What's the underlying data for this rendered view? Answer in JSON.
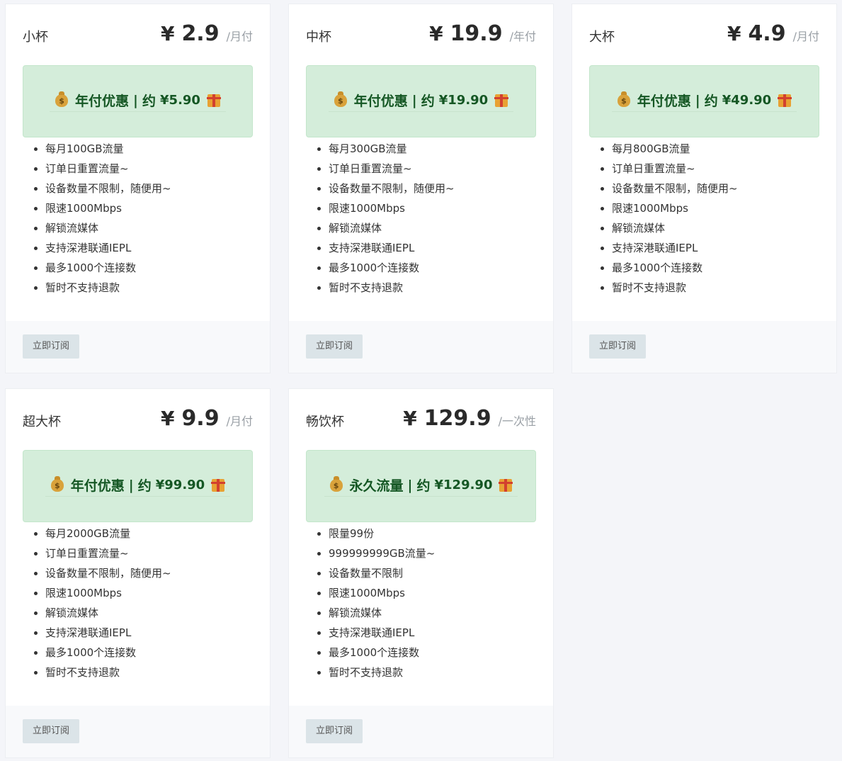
{
  "plans": [
    {
      "name": "小杯",
      "currency": "¥",
      "price": "2.9",
      "period": "/月付",
      "promo_title": "年付优惠",
      "promo_sep": "|",
      "promo_about": "约",
      "promo_price": "¥5.90",
      "features": [
        "每月100GB流量",
        "订单日重置流量~",
        "设备数量不限制，随便用~",
        "限速1000Mbps",
        "解锁流媒体",
        "支持深港联通IEPL",
        "最多1000个连接数",
        "暂时不支持退款"
      ],
      "button": "立即订阅"
    },
    {
      "name": "中杯",
      "currency": "¥",
      "price": "19.9",
      "period": "/年付",
      "promo_title": "年付优惠",
      "promo_sep": "|",
      "promo_about": "约",
      "promo_price": "¥19.90",
      "features": [
        "每月300GB流量",
        "订单日重置流量~",
        "设备数量不限制，随便用~",
        "限速1000Mbps",
        "解锁流媒体",
        "支持深港联通IEPL",
        "最多1000个连接数",
        "暂时不支持退款"
      ],
      "button": "立即订阅"
    },
    {
      "name": "大杯",
      "currency": "¥",
      "price": "4.9",
      "period": "/月付",
      "promo_title": "年付优惠",
      "promo_sep": "|",
      "promo_about": "约",
      "promo_price": "¥49.90",
      "features": [
        "每月800GB流量",
        "订单日重置流量~",
        "设备数量不限制，随便用~",
        "限速1000Mbps",
        "解锁流媒体",
        "支持深港联通IEPL",
        "最多1000个连接数",
        "暂时不支持退款"
      ],
      "button": "立即订阅"
    },
    {
      "name": "超大杯",
      "currency": "¥",
      "price": "9.9",
      "period": "/月付",
      "promo_title": "年付优惠",
      "promo_sep": "|",
      "promo_about": "约",
      "promo_price": "¥99.90",
      "features": [
        "每月2000GB流量",
        "订单日重置流量~",
        "设备数量不限制，随便用~",
        "限速1000Mbps",
        "解锁流媒体",
        "支持深港联通IEPL",
        "最多1000个连接数",
        "暂时不支持退款"
      ],
      "button": "立即订阅"
    },
    {
      "name": "畅饮杯",
      "currency": "¥",
      "price": "129.9",
      "period": "/一次性",
      "promo_title": "永久流量",
      "promo_sep": "|",
      "promo_about": "约",
      "promo_price": "¥129.90",
      "features": [
        "限量99份",
        "999999999GB流量~",
        "设备数量不限制",
        "限速1000Mbps",
        "解锁流媒体",
        "支持深港联通IEPL",
        "最多1000个连接数",
        "暂时不支持退款"
      ],
      "button": "立即订阅"
    }
  ],
  "icons": {
    "promo_left": "money-bag-icon",
    "promo_right": "gift-icon"
  },
  "colors": {
    "promo_bg": "#d4edda",
    "promo_text": "#155724",
    "button_bg": "#dbe4e8"
  }
}
